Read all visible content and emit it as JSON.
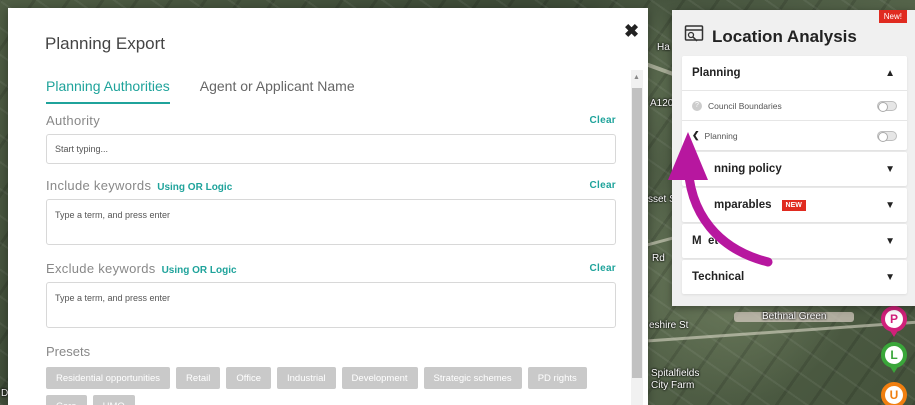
{
  "map": {
    "labels": [
      "Ha",
      "A120",
      "sset S",
      "Rd",
      "eshire St",
      "Bethnal Green",
      "Spitalfields",
      "City Farm",
      "D"
    ],
    "markers": [
      {
        "letter": "P",
        "color": "#d0207a"
      },
      {
        "letter": "L",
        "color": "#3aa63a"
      },
      {
        "letter": "U",
        "color": "#f07f10"
      }
    ]
  },
  "modal": {
    "title": "Planning Export",
    "close_glyph": "✖",
    "tabs": [
      {
        "label": "Planning Authorities",
        "active": true
      },
      {
        "label": "Agent or Applicant Name",
        "active": false
      }
    ],
    "authority": {
      "label": "Authority",
      "clear": "Clear",
      "placeholder": "Start typing..."
    },
    "include": {
      "label": "Include keywords",
      "logic": "Using OR Logic",
      "clear": "Clear",
      "placeholder": "Type a term, and press enter"
    },
    "exclude": {
      "label": "Exclude keywords",
      "logic": "Using OR Logic",
      "clear": "Clear",
      "placeholder": "Type a term, and press enter"
    },
    "presets": {
      "label": "Presets",
      "chips": [
        "Residential opportunities",
        "Retail",
        "Office",
        "Industrial",
        "Development",
        "Strategic schemes",
        "PD rights",
        "Care",
        "HMO"
      ]
    }
  },
  "panel": {
    "title": "Location Analysis",
    "badge": "New!",
    "sections": [
      {
        "label": "Planning",
        "expanded": true,
        "rows": [
          {
            "label": "Council Boundaries",
            "prefix": "?"
          },
          {
            "label": "Planning",
            "prefix": "❮"
          }
        ]
      },
      {
        "label": "Planning policy",
        "display": "nning policy"
      },
      {
        "label": "Comparables",
        "display": "mparables",
        "tag": "NEW"
      },
      {
        "label": "Market",
        "display": "M  et"
      },
      {
        "label": "Technical"
      }
    ]
  },
  "colors": {
    "accent": "#1fa39b",
    "badge": "#e02b20",
    "arrow": "#b7179f"
  }
}
